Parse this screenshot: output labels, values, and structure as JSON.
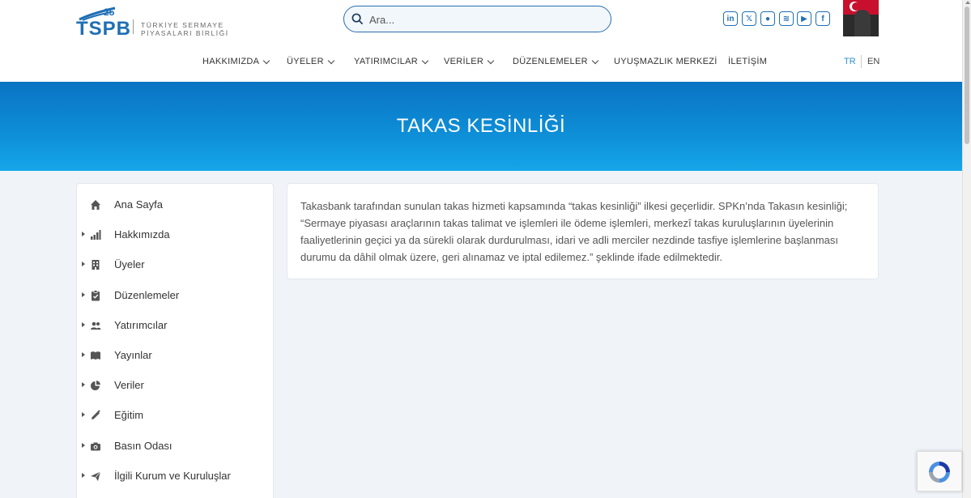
{
  "logo": {
    "brand": "TSPB",
    "anniversary": "25",
    "line1": "TÜRKİYE SERMAYE",
    "line2": "PİYASALARI BİRLİĞİ"
  },
  "search": {
    "placeholder": "Ara..."
  },
  "social": [
    {
      "name": "linkedin-icon",
      "glyph": "in"
    },
    {
      "name": "x-twitter-icon",
      "glyph": "𝕏"
    },
    {
      "name": "flickr-icon",
      "glyph": "●"
    },
    {
      "name": "spotify-icon",
      "glyph": "≋"
    },
    {
      "name": "youtube-icon",
      "glyph": "▶"
    },
    {
      "name": "facebook-icon",
      "glyph": "f"
    }
  ],
  "nav": {
    "items": [
      {
        "label": "HAKKIMIZDA",
        "dropdown": true
      },
      {
        "label": "ÜYELER",
        "dropdown": true
      },
      {
        "label": "YATIRIMCILAR",
        "dropdown": true
      },
      {
        "label": "VERİLER",
        "dropdown": true
      },
      {
        "label": "DÜZENLEMELER",
        "dropdown": true
      },
      {
        "label": "UYUŞMAZLIK MERKEZİ",
        "dropdown": false
      },
      {
        "label": "İLETİŞİM",
        "dropdown": false
      }
    ],
    "lang_tr": "TR",
    "lang_en": "EN"
  },
  "banner": {
    "title": "TAKAS KESİNLİĞİ"
  },
  "sidebar": {
    "items": [
      {
        "label": "Ana Sayfa",
        "icon": "home-icon",
        "arrow": false
      },
      {
        "label": "Hakkımızda",
        "icon": "chart-bars-icon",
        "arrow": true
      },
      {
        "label": "Üyeler",
        "icon": "building-icon",
        "arrow": true
      },
      {
        "label": "Düzenlemeler",
        "icon": "clipboard-check-icon",
        "arrow": true
      },
      {
        "label": "Yatırımcılar",
        "icon": "users-icon",
        "arrow": true
      },
      {
        "label": "Yayınlar",
        "icon": "book-icon",
        "arrow": true
      },
      {
        "label": "Veriler",
        "icon": "pie-chart-icon",
        "arrow": true
      },
      {
        "label": "Eğitim",
        "icon": "pencil-icon",
        "arrow": true
      },
      {
        "label": "Basın Odası",
        "icon": "camera-icon",
        "arrow": true
      },
      {
        "label": "İlgili Kurum ve Kuruluşlar",
        "icon": "paper-plane-icon",
        "arrow": true
      }
    ]
  },
  "content": {
    "text": "Takasbank tarafından sunulan takas hizmeti kapsamında “takas kesinliği” ilkesi geçerlidir. SPKn’nda Takasın kesinliği; “Sermaye piyasası araçlarının takas talimat ve işlemleri ile ödeme işlemleri, merkezî takas kuruluşlarının üyelerinin faaliyetlerinin geçici ya da sürekli olarak durdurulması, idari ve adli merciler nezdinde tasfiye işlemlerine başlanması durumu da dâhil olmak üzere, geri alınamaz ve iptal edilemez.” şeklinde ifade edilmektedir."
  },
  "colors": {
    "brand_blue": "#1f6fb4",
    "banner_top": "#0a73c2",
    "banner_bottom": "#16a6e8",
    "lang_active": "#2a8fd0"
  }
}
